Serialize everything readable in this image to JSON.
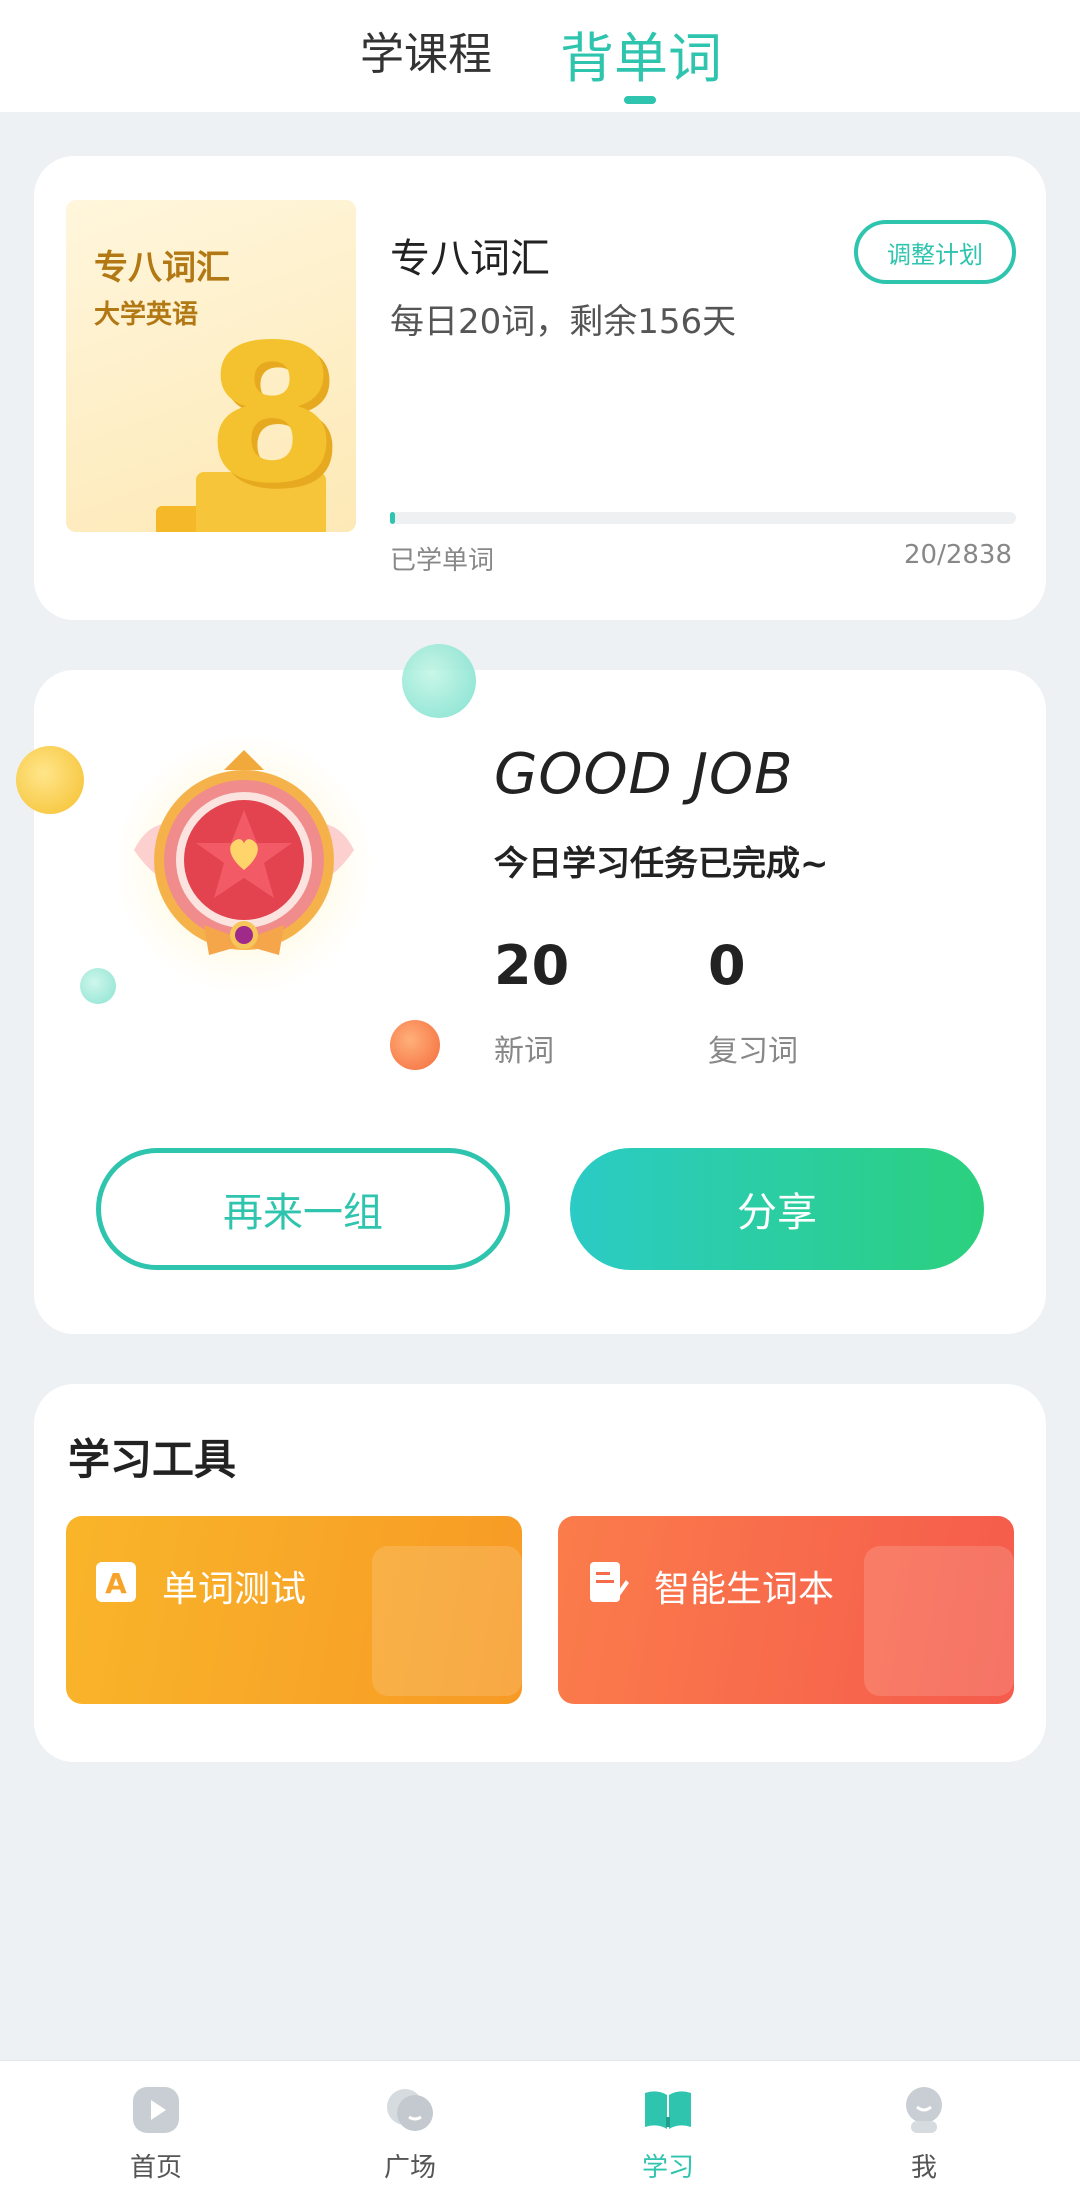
{
  "tabs": {
    "courses": "学课程",
    "words": "背单词"
  },
  "plan": {
    "cover_title": "专八词汇",
    "cover_subtitle": "大学英语",
    "cover_number": "8",
    "title": "专八词汇",
    "description": "每日20词，剩余156天",
    "adjust_button": "调整计划",
    "learned_label": "已学单词",
    "learned_count": "20/2838",
    "progress_fraction": 0.007
  },
  "result": {
    "headline": "GOOD JOB",
    "message": "今日学习任务已完成~",
    "new_words_value": "20",
    "new_words_label": "新词",
    "review_words_value": "0",
    "review_words_label": "复习词",
    "again_button": "再来一组",
    "share_button": "分享"
  },
  "tools": {
    "title": "学习工具",
    "items": [
      {
        "label": "单词测试",
        "icon": "letter-a-icon"
      },
      {
        "label": "智能生词本",
        "icon": "notebook-pen-icon"
      }
    ]
  },
  "nav": {
    "items": [
      {
        "label": "首页",
        "icon": "play-icon"
      },
      {
        "label": "广场",
        "icon": "chat-bubble-icon"
      },
      {
        "label": "学习",
        "icon": "open-book-icon"
      },
      {
        "label": "我",
        "icon": "profile-icon"
      }
    ],
    "active_index": 2
  },
  "colors": {
    "accent": "#2fc4ae",
    "tool_test": "#f9a828",
    "tool_vocab": "#f76b4b"
  }
}
